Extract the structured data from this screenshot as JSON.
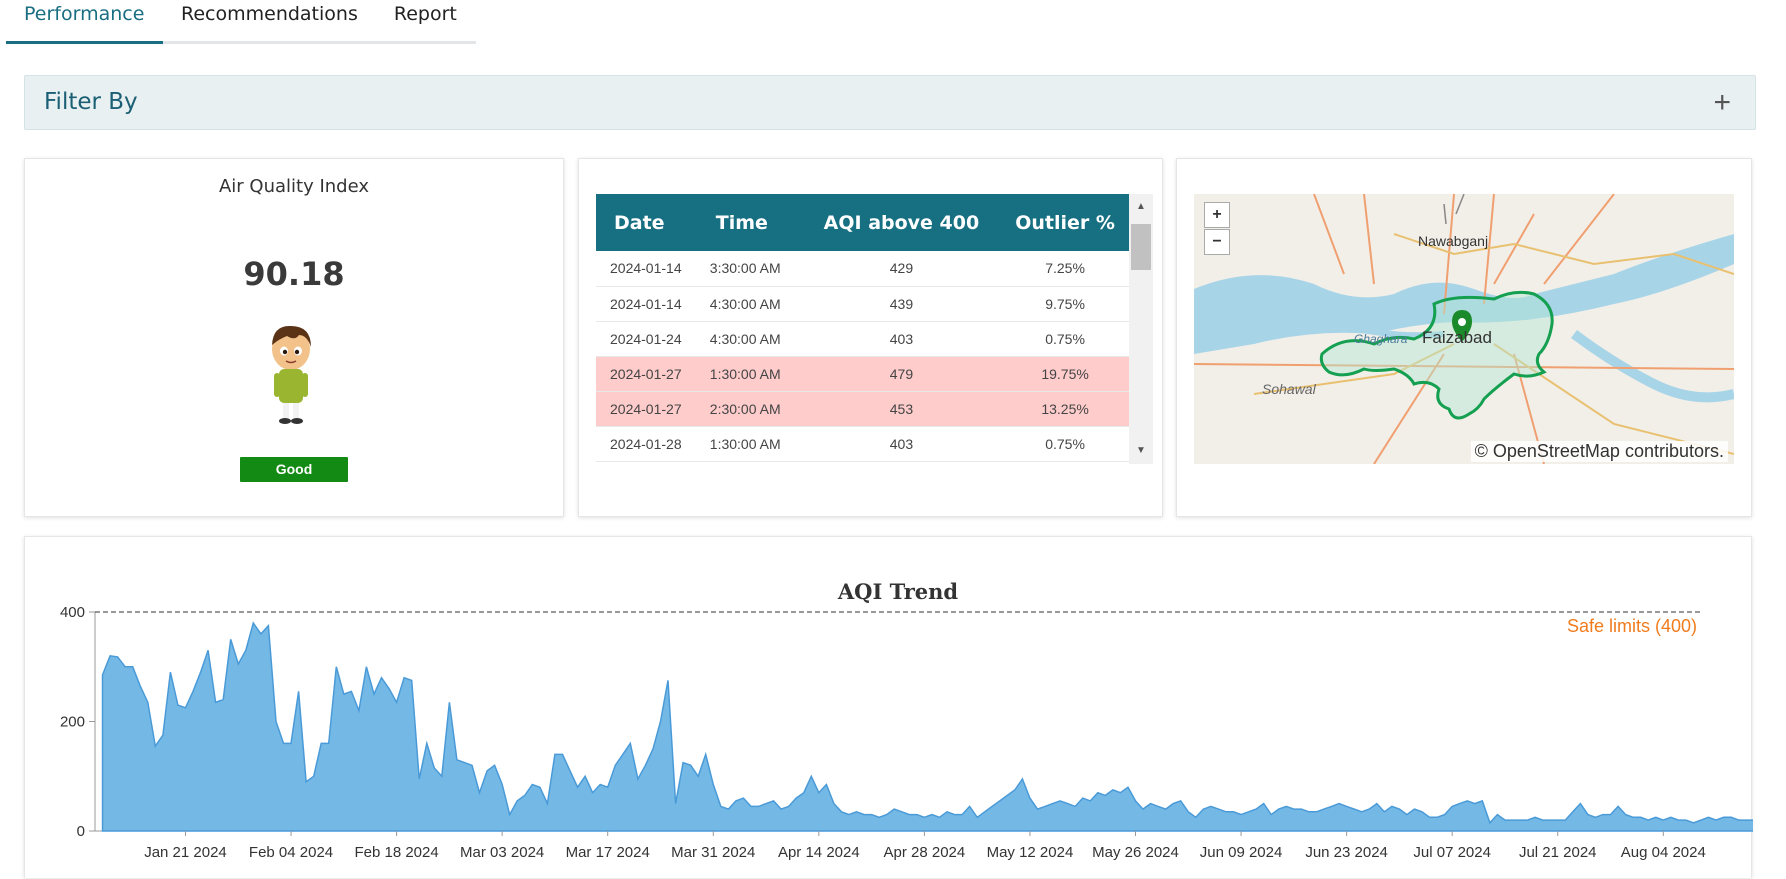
{
  "tabs": [
    {
      "label": "Performance"
    },
    {
      "label": "Recommendations"
    },
    {
      "label": "Report"
    }
  ],
  "filter": {
    "title": "Filter By",
    "toggle": "+"
  },
  "aqi_card": {
    "title": "Air Quality Index",
    "value": "90.18",
    "status": "Good",
    "status_color": "#138a13"
  },
  "outlier_table": {
    "headers": [
      "Date",
      "Time",
      "AQI above 400",
      "Outlier %"
    ],
    "rows": [
      {
        "date": "2024-01-14",
        "time": "3:30:00 AM",
        "aqi": "429",
        "outlier": "7.25%",
        "highlight": false
      },
      {
        "date": "2024-01-14",
        "time": "4:30:00 AM",
        "aqi": "439",
        "outlier": "9.75%",
        "highlight": false
      },
      {
        "date": "2024-01-24",
        "time": "4:30:00 AM",
        "aqi": "403",
        "outlier": "0.75%",
        "highlight": false
      },
      {
        "date": "2024-01-27",
        "time": "1:30:00 AM",
        "aqi": "479",
        "outlier": "19.75%",
        "highlight": true
      },
      {
        "date": "2024-01-27",
        "time": "2:30:00 AM",
        "aqi": "453",
        "outlier": "13.25%",
        "highlight": true
      },
      {
        "date": "2024-01-28",
        "time": "1:30:00 AM",
        "aqi": "403",
        "outlier": "0.75%",
        "highlight": false
      }
    ]
  },
  "map": {
    "zoom_in": "+",
    "zoom_out": "−",
    "attribution": "© OpenStreetMap contributors.",
    "labels": {
      "nawabganj": "Nawabganj",
      "city": "Faizabad",
      "sohawal": "Sohawal",
      "ghaghara": "Ghaghara"
    }
  },
  "chart_data": {
    "type": "area",
    "title": "AQI Trend",
    "color": "#74b9e6",
    "threshold": {
      "value": 400,
      "label": "Safe limits (400)",
      "color": "#f07c1e"
    },
    "ylim": [
      0,
      400
    ],
    "yticks": [
      0,
      200,
      400
    ],
    "xlim": [
      "2024-01-09",
      "2024-08-09"
    ],
    "xtick_labels": [
      "Jan 21 2024",
      "Feb 04 2024",
      "Feb 18 2024",
      "Mar 03 2024",
      "Mar 17 2024",
      "Mar 31 2024",
      "Apr 14 2024",
      "Apr 28 2024",
      "May 12 2024",
      "May 26 2024",
      "Jun 09 2024",
      "Jun 23 2024",
      "Jul 07 2024",
      "Jul 21 2024",
      "Aug 04 2024"
    ],
    "start_date": "2024-01-10",
    "values": [
      285,
      320,
      318,
      300,
      300,
      265,
      235,
      155,
      175,
      290,
      230,
      225,
      255,
      290,
      330,
      235,
      240,
      350,
      305,
      330,
      380,
      360,
      375,
      200,
      160,
      160,
      255,
      90,
      100,
      160,
      160,
      300,
      250,
      255,
      220,
      300,
      250,
      280,
      260,
      235,
      280,
      275,
      95,
      160,
      115,
      100,
      235,
      130,
      125,
      120,
      70,
      110,
      120,
      85,
      30,
      55,
      65,
      85,
      80,
      50,
      140,
      140,
      110,
      80,
      100,
      70,
      85,
      80,
      120,
      140,
      160,
      95,
      120,
      150,
      200,
      275,
      50,
      125,
      120,
      100,
      140,
      85,
      45,
      40,
      55,
      60,
      45,
      45,
      50,
      55,
      40,
      45,
      60,
      70,
      100,
      70,
      85,
      50,
      35,
      30,
      35,
      30,
      30,
      25,
      30,
      40,
      35,
      30,
      30,
      25,
      30,
      25,
      35,
      30,
      30,
      45,
      25,
      35,
      45,
      55,
      65,
      75,
      95,
      60,
      40,
      45,
      50,
      55,
      50,
      45,
      60,
      55,
      70,
      65,
      75,
      70,
      80,
      55,
      40,
      50,
      45,
      40,
      50,
      55,
      35,
      25,
      40,
      45,
      40,
      35,
      35,
      30,
      35,
      40,
      50,
      30,
      40,
      45,
      40,
      40,
      35,
      35,
      40,
      45,
      50,
      45,
      40,
      35,
      40,
      50,
      35,
      45,
      40,
      30,
      40,
      35,
      25,
      25,
      30,
      45,
      50,
      55,
      50,
      55,
      15,
      30,
      20,
      20,
      20,
      20,
      25,
      20,
      20,
      20,
      20,
      35,
      50,
      30,
      25,
      30,
      30,
      45,
      30,
      25,
      25,
      20,
      25,
      20,
      25,
      20,
      20,
      15,
      20,
      25,
      20,
      25,
      25,
      20,
      20,
      20,
      15,
      20,
      30,
      30,
      25
    ]
  }
}
